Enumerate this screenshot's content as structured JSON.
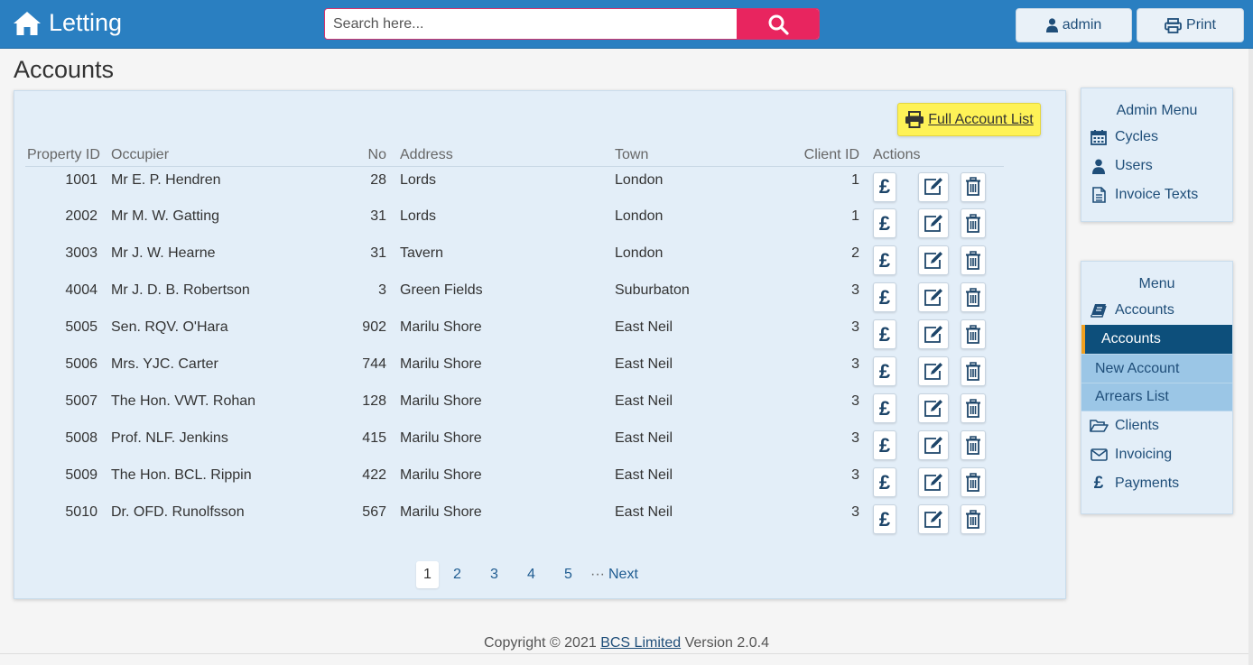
{
  "header": {
    "brand": "Letting",
    "search_placeholder": "Search here...",
    "admin_label": "admin",
    "print_label": "Print"
  },
  "page": {
    "title": "Accounts"
  },
  "main": {
    "full_list_label": "Full Account List",
    "columns": [
      "Property ID",
      "Occupier",
      "No",
      "Address",
      "Town",
      "Client ID",
      "Actions"
    ],
    "rows": [
      {
        "pid": "1001",
        "occupier": "Mr E. P. Hendren",
        "no": "28",
        "address": "Lords",
        "town": "London",
        "client": "1"
      },
      {
        "pid": "2002",
        "occupier": "Mr M. W. Gatting",
        "no": "31",
        "address": "Lords",
        "town": "London",
        "client": "1"
      },
      {
        "pid": "3003",
        "occupier": "Mr J. W. Hearne",
        "no": "31",
        "address": "Tavern",
        "town": "London",
        "client": "2"
      },
      {
        "pid": "4004",
        "occupier": "Mr J. D. B. Robertson",
        "no": "3",
        "address": "Green Fields",
        "town": "Suburbaton",
        "client": "3"
      },
      {
        "pid": "5005",
        "occupier": "Sen. RQV. O'Hara",
        "no": "902",
        "address": "Marilu Shore",
        "town": "East Neil",
        "client": "3"
      },
      {
        "pid": "5006",
        "occupier": "Mrs. YJC. Carter",
        "no": "744",
        "address": "Marilu Shore",
        "town": "East Neil",
        "client": "3"
      },
      {
        "pid": "5007",
        "occupier": "The Hon. VWT. Rohan",
        "no": "128",
        "address": "Marilu Shore",
        "town": "East Neil",
        "client": "3"
      },
      {
        "pid": "5008",
        "occupier": "Prof. NLF. Jenkins",
        "no": "415",
        "address": "Marilu Shore",
        "town": "East Neil",
        "client": "3"
      },
      {
        "pid": "5009",
        "occupier": "The Hon. BCL. Rippin",
        "no": "422",
        "address": "Marilu Shore",
        "town": "East Neil",
        "client": "3"
      },
      {
        "pid": "5010",
        "occupier": "Dr. OFD. Runolfsson",
        "no": "567",
        "address": "Marilu Shore",
        "town": "East Neil",
        "client": "3"
      }
    ],
    "pay_symbol": "£",
    "pagination": {
      "current": "1",
      "pages": [
        "2",
        "3",
        "4",
        "5"
      ],
      "ellipsis": "···",
      "next": "Next"
    }
  },
  "admin_menu": {
    "title": "Admin Menu",
    "items": [
      {
        "label": "Cycles",
        "icon": "calendar-icon"
      },
      {
        "label": "Users",
        "icon": "user-icon"
      },
      {
        "label": "Invoice Texts",
        "icon": "document-icon"
      }
    ]
  },
  "menu": {
    "title": "Menu",
    "accounts_label": "Accounts",
    "sub_items": [
      "Accounts",
      "New Account",
      "Arrears List"
    ],
    "clients_label": "Clients",
    "invoicing_label": "Invoicing",
    "payments_label": "Payments",
    "payments_symbol": "£"
  },
  "footer": {
    "prefix": "Copyright © 2021",
    "company": "BCS Limited",
    "version": "Version 2.0.4"
  },
  "colors": {
    "header": "#2a7fc1",
    "search_button": "#e8255f",
    "panel": "#e3eef8",
    "highlight_button": "#fef257",
    "active_sub_item": "#0d4f7b",
    "sub_item": "#9bc6e6",
    "active_marker": "#f0a020"
  }
}
